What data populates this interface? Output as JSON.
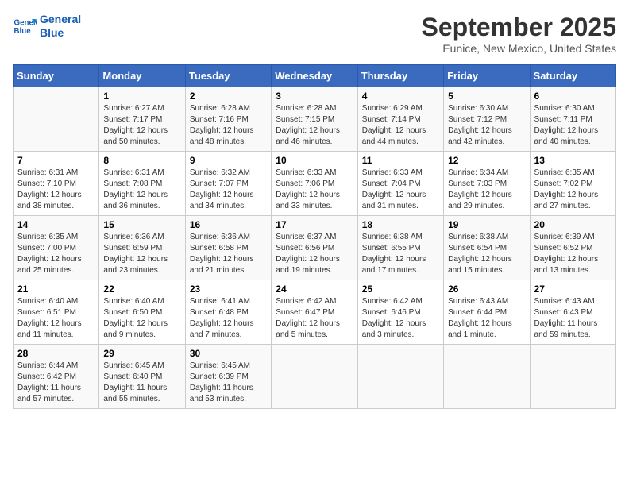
{
  "logo": {
    "line1": "General",
    "line2": "Blue"
  },
  "title": "September 2025",
  "subtitle": "Eunice, New Mexico, United States",
  "days_header": [
    "Sunday",
    "Monday",
    "Tuesday",
    "Wednesday",
    "Thursday",
    "Friday",
    "Saturday"
  ],
  "weeks": [
    [
      {
        "day": "",
        "info": ""
      },
      {
        "day": "1",
        "info": "Sunrise: 6:27 AM\nSunset: 7:17 PM\nDaylight: 12 hours\nand 50 minutes."
      },
      {
        "day": "2",
        "info": "Sunrise: 6:28 AM\nSunset: 7:16 PM\nDaylight: 12 hours\nand 48 minutes."
      },
      {
        "day": "3",
        "info": "Sunrise: 6:28 AM\nSunset: 7:15 PM\nDaylight: 12 hours\nand 46 minutes."
      },
      {
        "day": "4",
        "info": "Sunrise: 6:29 AM\nSunset: 7:14 PM\nDaylight: 12 hours\nand 44 minutes."
      },
      {
        "day": "5",
        "info": "Sunrise: 6:30 AM\nSunset: 7:12 PM\nDaylight: 12 hours\nand 42 minutes."
      },
      {
        "day": "6",
        "info": "Sunrise: 6:30 AM\nSunset: 7:11 PM\nDaylight: 12 hours\nand 40 minutes."
      }
    ],
    [
      {
        "day": "7",
        "info": "Sunrise: 6:31 AM\nSunset: 7:10 PM\nDaylight: 12 hours\nand 38 minutes."
      },
      {
        "day": "8",
        "info": "Sunrise: 6:31 AM\nSunset: 7:08 PM\nDaylight: 12 hours\nand 36 minutes."
      },
      {
        "day": "9",
        "info": "Sunrise: 6:32 AM\nSunset: 7:07 PM\nDaylight: 12 hours\nand 34 minutes."
      },
      {
        "day": "10",
        "info": "Sunrise: 6:33 AM\nSunset: 7:06 PM\nDaylight: 12 hours\nand 33 minutes."
      },
      {
        "day": "11",
        "info": "Sunrise: 6:33 AM\nSunset: 7:04 PM\nDaylight: 12 hours\nand 31 minutes."
      },
      {
        "day": "12",
        "info": "Sunrise: 6:34 AM\nSunset: 7:03 PM\nDaylight: 12 hours\nand 29 minutes."
      },
      {
        "day": "13",
        "info": "Sunrise: 6:35 AM\nSunset: 7:02 PM\nDaylight: 12 hours\nand 27 minutes."
      }
    ],
    [
      {
        "day": "14",
        "info": "Sunrise: 6:35 AM\nSunset: 7:00 PM\nDaylight: 12 hours\nand 25 minutes."
      },
      {
        "day": "15",
        "info": "Sunrise: 6:36 AM\nSunset: 6:59 PM\nDaylight: 12 hours\nand 23 minutes."
      },
      {
        "day": "16",
        "info": "Sunrise: 6:36 AM\nSunset: 6:58 PM\nDaylight: 12 hours\nand 21 minutes."
      },
      {
        "day": "17",
        "info": "Sunrise: 6:37 AM\nSunset: 6:56 PM\nDaylight: 12 hours\nand 19 minutes."
      },
      {
        "day": "18",
        "info": "Sunrise: 6:38 AM\nSunset: 6:55 PM\nDaylight: 12 hours\nand 17 minutes."
      },
      {
        "day": "19",
        "info": "Sunrise: 6:38 AM\nSunset: 6:54 PM\nDaylight: 12 hours\nand 15 minutes."
      },
      {
        "day": "20",
        "info": "Sunrise: 6:39 AM\nSunset: 6:52 PM\nDaylight: 12 hours\nand 13 minutes."
      }
    ],
    [
      {
        "day": "21",
        "info": "Sunrise: 6:40 AM\nSunset: 6:51 PM\nDaylight: 12 hours\nand 11 minutes."
      },
      {
        "day": "22",
        "info": "Sunrise: 6:40 AM\nSunset: 6:50 PM\nDaylight: 12 hours\nand 9 minutes."
      },
      {
        "day": "23",
        "info": "Sunrise: 6:41 AM\nSunset: 6:48 PM\nDaylight: 12 hours\nand 7 minutes."
      },
      {
        "day": "24",
        "info": "Sunrise: 6:42 AM\nSunset: 6:47 PM\nDaylight: 12 hours\nand 5 minutes."
      },
      {
        "day": "25",
        "info": "Sunrise: 6:42 AM\nSunset: 6:46 PM\nDaylight: 12 hours\nand 3 minutes."
      },
      {
        "day": "26",
        "info": "Sunrise: 6:43 AM\nSunset: 6:44 PM\nDaylight: 12 hours\nand 1 minute."
      },
      {
        "day": "27",
        "info": "Sunrise: 6:43 AM\nSunset: 6:43 PM\nDaylight: 11 hours\nand 59 minutes."
      }
    ],
    [
      {
        "day": "28",
        "info": "Sunrise: 6:44 AM\nSunset: 6:42 PM\nDaylight: 11 hours\nand 57 minutes."
      },
      {
        "day": "29",
        "info": "Sunrise: 6:45 AM\nSunset: 6:40 PM\nDaylight: 11 hours\nand 55 minutes."
      },
      {
        "day": "30",
        "info": "Sunrise: 6:45 AM\nSunset: 6:39 PM\nDaylight: 11 hours\nand 53 minutes."
      },
      {
        "day": "",
        "info": ""
      },
      {
        "day": "",
        "info": ""
      },
      {
        "day": "",
        "info": ""
      },
      {
        "day": "",
        "info": ""
      }
    ]
  ]
}
